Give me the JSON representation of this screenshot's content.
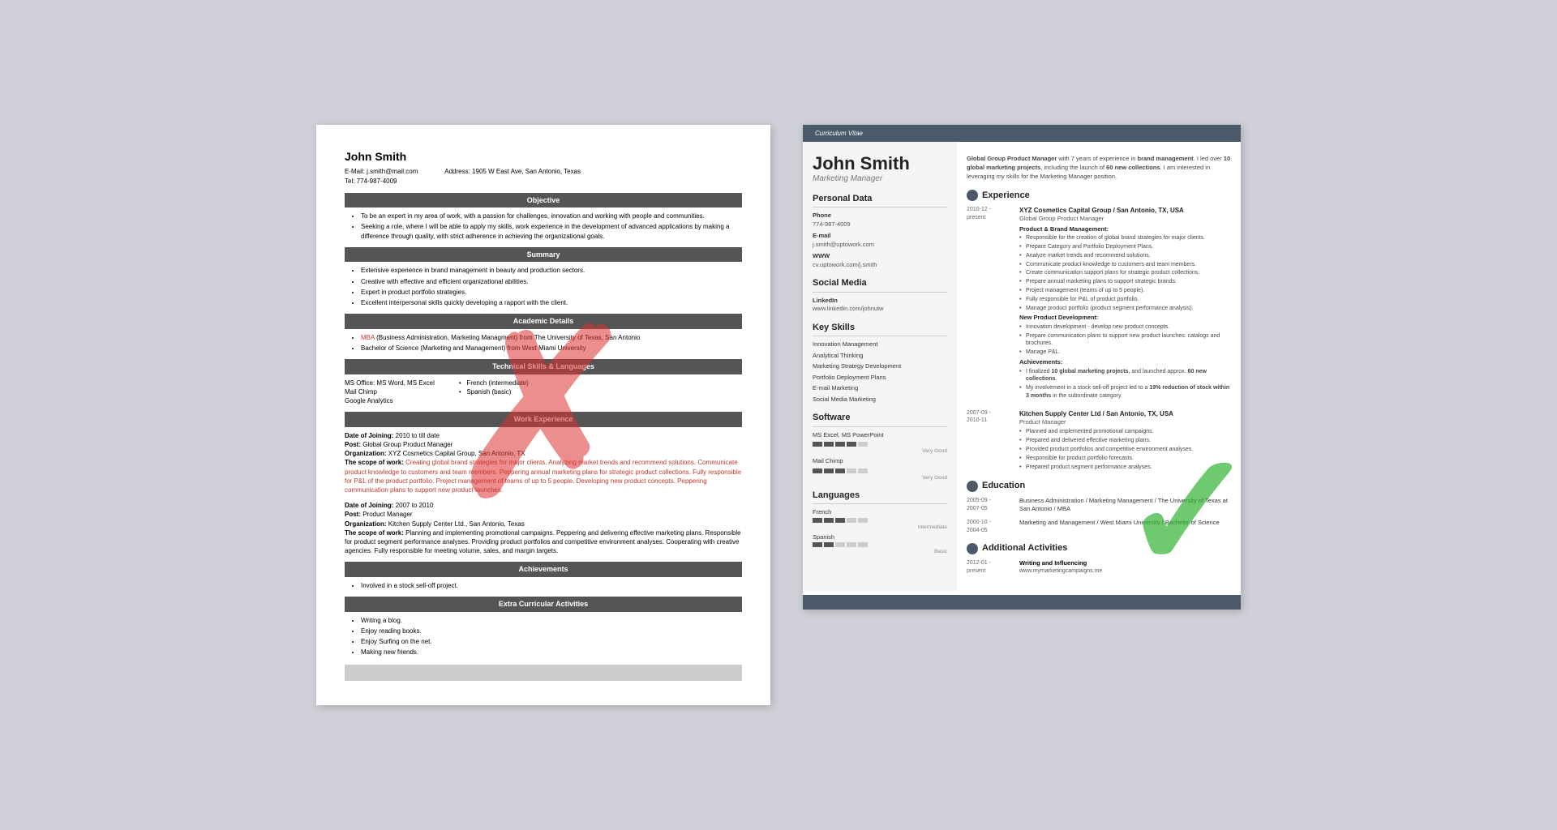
{
  "left_resume": {
    "name": "John Smith",
    "email": "E-Mail: j.smith@mail.com",
    "tel": "Tel: 774-987-4009",
    "address": "Address: 1905 W East Ave, San Antonio, Texas",
    "sections": {
      "objective": {
        "header": "Objective",
        "bullets": [
          "To be an expert in my area of work, with a passion for challenges, innovation and working with people and communities.",
          "Seeking a role, where I will be able to apply my skills, work experience in the development of advanced applications by making a difference through quality, with strict adherence in achieving the organizational goals."
        ]
      },
      "summary": {
        "header": "Summary",
        "bullets": [
          "Extensive experience in brand management in beauty and production sectors.",
          "Creative with effective and efficient organizational abilities.",
          "Expert in product portfolio strategies.",
          "Excellent interpersonal skills quickly developing a rapport with the client."
        ]
      },
      "academic": {
        "header": "Academic Details",
        "bullets": [
          "MBA (Business Administration, Marketing Managment) from The University of Texas, San Antonio",
          "Bachelor of Science (Marketing and Management) from West Miami University"
        ]
      },
      "technical": {
        "header": "Technical Skills & Languages",
        "skills_left": [
          "MS Office: MS Word, MS Excel",
          "Mail Chimp",
          "Google Analytics"
        ],
        "skills_right": [
          "French (intermediate)",
          "Spanish (basic)"
        ]
      },
      "work": {
        "header": "Work Experience",
        "entries": [
          {
            "joining": "Date of Joining: 2010 to till date",
            "post": "Post: Global Group Product Manager",
            "org": "Organization: XYZ Cosmetics Capital Group, San Antonio, TX",
            "scope_label": "The scope of work:",
            "scope": "Creating global brand strategies for major clients. Analyzing market trends and recommend solutions. Communicate product knowledge to customers and team members. Peppering annual marketing plans for strategic product collections. Fully responsible for P&L of the product portfolio. Project management of teams of up to 5 people. Developing new product concepts. Peppering communication plans to support new product launches."
          },
          {
            "joining": "Date of Joining: 2007 to 2010",
            "post": "Post: Product Manager",
            "org": "Organization: Kitchen Supply Center Ltd., San Antonio, Texas",
            "scope_label": "The scope of work:",
            "scope": "Planning and implementing promotional campaigns. Peppering and delivering effective marketing plans. Responsible for product segment performance analyses. Providing product portfolios and competitive environment analyses. Cooperating with creative agencies. Fully responsible for meeting volume, sales, and margin targets."
          }
        ]
      },
      "achievements": {
        "header": "Achievements",
        "bullets": [
          "Involved in a stock sell-off project."
        ]
      },
      "extra": {
        "header": "Extra Curricular Activities",
        "bullets": [
          "Writing a blog.",
          "Enjoy reading books.",
          "Enjoy Surfing on the net.",
          "Making new friends."
        ]
      }
    }
  },
  "right_resume": {
    "banner": "Curriculum Vitae",
    "name": "John Smith",
    "title": "Marketing Manager",
    "intro": "Global Group Product Manager with 7 years of experience in brand management. I led over 10 global marketing projects, including the launch of 60 new collections. I am interested in leveraging my skills for the Marketing Manager position.",
    "personal_data": {
      "section": "Personal Data",
      "phone_label": "Phone",
      "phone": "774-987-4009",
      "email_label": "E-mail",
      "email": "j.smith@uptowork.com",
      "www_label": "WWW",
      "www": "cv.uptowork.com/j.smith"
    },
    "social_media": {
      "section": "Social Media",
      "linkedin_label": "LinkedIn",
      "linkedin": "www.linkedin.com/johnutw"
    },
    "key_skills": {
      "section": "Key Skills",
      "skills": [
        "Innovation Management",
        "Analytical Thinking",
        "Marketing Strategy Development",
        "Portfolio Deployment Plans",
        "E-mail Marketing",
        "Social Media Marketing"
      ]
    },
    "software": {
      "section": "Software",
      "items": [
        {
          "name": "MS Excel, MS PowerPoint",
          "level": 4,
          "label": "Very Good"
        },
        {
          "name": "Mail Chimp",
          "level": 3,
          "label": "Very Good"
        }
      ]
    },
    "languages": {
      "section": "Languages",
      "items": [
        {
          "name": "French",
          "level": 3,
          "max": 5,
          "label": "Intermediate"
        },
        {
          "name": "Spanish",
          "level": 2,
          "max": 5,
          "label": "Basic"
        }
      ]
    },
    "experience": {
      "section": "Experience",
      "entries": [
        {
          "dates": "2010-12 - present",
          "company": "XYZ Cosmetics Capital Group / San Antonio, TX, USA",
          "role": "Global Group Product Manager",
          "sub_headers": [
            {
              "title": "Product & Brand Management:",
              "bullets": [
                "Responsible for the creation of global brand strategies for major clients.",
                "Prepare Category and Portfolio Deployment Plans.",
                "Analyze market trends and recommend solutions.",
                "Communicate product knowledge to customers and team members.",
                "Create communication support plans for strategic product collections.",
                "Prepare annual marketing plans to support strategic brands.",
                "Project management (teams of up to 5 people).",
                "Fully responsible for P&L of product portfolio.",
                "Manage product portfolio (product segment performance analysis)."
              ]
            },
            {
              "title": "New Product Development:",
              "bullets": [
                "Innovation development - develop new product concepts.",
                "Prepare communication plans to support new product launches: catalogs and brochures.",
                "Manage P&L."
              ]
            },
            {
              "title": "Achievements:",
              "bullets": [
                "I finalized 10 global marketing projects, and launched approx. 60 new collections.",
                "My involvement in a stock sell-off project led to a 19% reduction of stock within 3 months in the subordinate category."
              ]
            }
          ]
        },
        {
          "dates": "2007-09 - 2010-11",
          "company": "Kitchen Supply Center Ltd / San Antonio, TX, USA",
          "role": "Product Manager",
          "sub_headers": [
            {
              "title": "",
              "bullets": [
                "Planned and implemented promotional campaigns.",
                "Prepared and delivered effective marketing plans.",
                "Provided product portfolios and competitive environment analyses.",
                "Responsible for product portfolio forecasts.",
                "Prepared product segment performance analyses."
              ]
            }
          ]
        }
      ]
    },
    "education": {
      "section": "Education",
      "entries": [
        {
          "dates": "2005-09 - 2007-05",
          "text": "Business Administration / Marketing Management / The University of Texas at San Antonio / MBA"
        },
        {
          "dates": "2000-10 - 2004-05",
          "text": "Marketing and Management / West Miami University / Bachelor of Science"
        }
      ]
    },
    "additional": {
      "section": "Additional Activities",
      "entries": [
        {
          "dates": "2012-01 - present",
          "title": "Writing and Influencing",
          "value": "www.mymarketingcampaigns.me"
        }
      ]
    }
  }
}
